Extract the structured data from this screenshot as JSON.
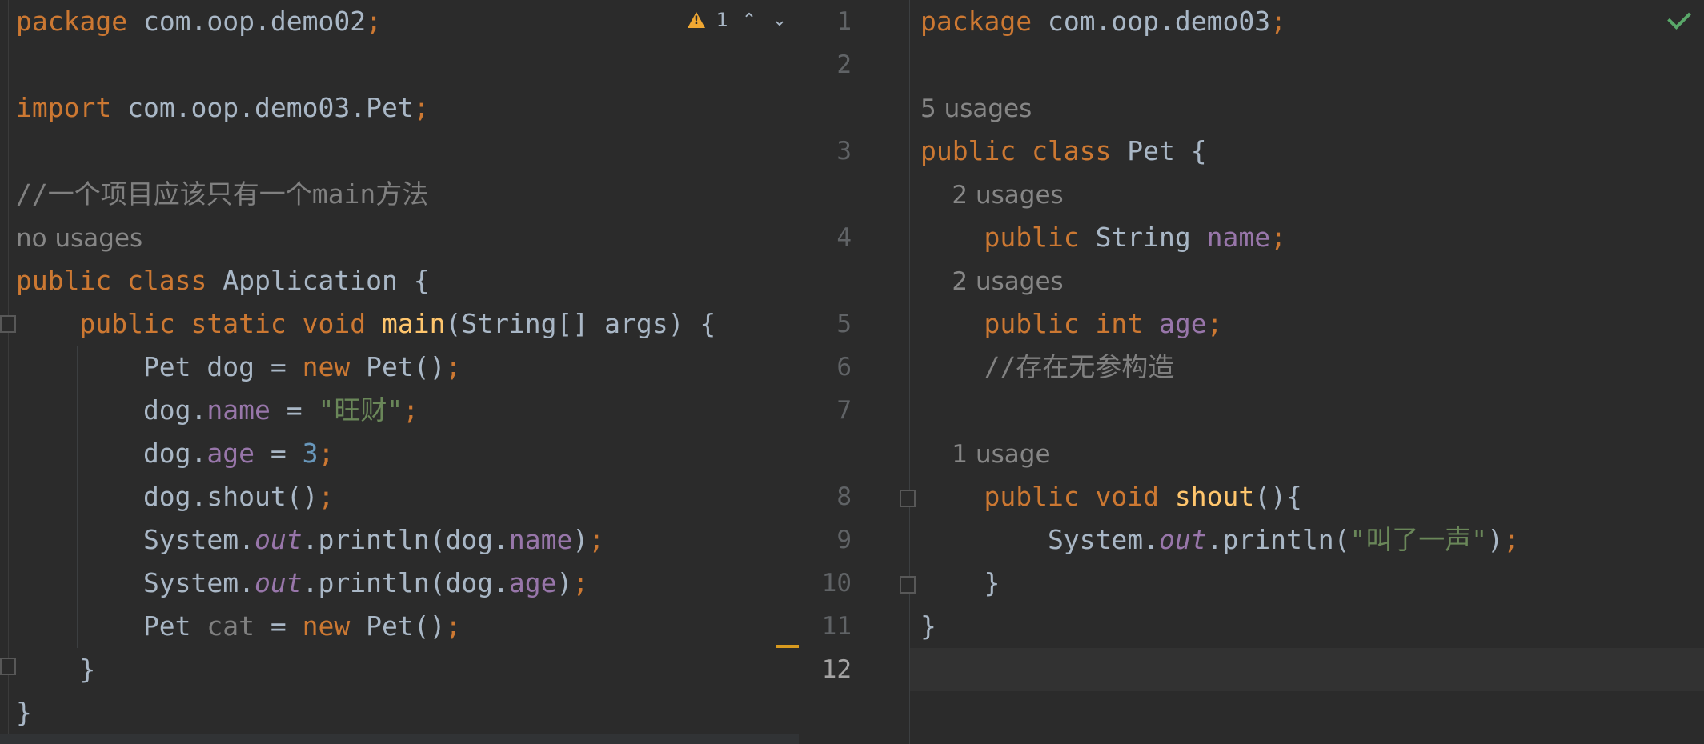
{
  "left_editor": {
    "inspections": {
      "icon": "warning-triangle-icon",
      "count": "1"
    },
    "lines": [
      {
        "segments": [
          {
            "t": "package",
            "c": "kw"
          },
          {
            "t": " com.oop.demo02",
            "c": ""
          },
          {
            "t": ";",
            "c": "pu"
          }
        ]
      },
      {
        "segments": []
      },
      {
        "segments": [
          {
            "t": "import",
            "c": "kw"
          },
          {
            "t": " com.oop.demo03.Pet",
            "c": ""
          },
          {
            "t": ";",
            "c": "pu"
          }
        ]
      },
      {
        "segments": []
      },
      {
        "segments": [
          {
            "t": "//一个项目应该只有一个main方法",
            "c": "cm"
          }
        ]
      },
      {
        "usage": "no usages"
      },
      {
        "segments": [
          {
            "t": "public class ",
            "c": "kw"
          },
          {
            "t": "Application {",
            "c": ""
          }
        ]
      },
      {
        "segments": [
          {
            "t": "    ",
            "c": ""
          },
          {
            "t": "public static void ",
            "c": "kw"
          },
          {
            "t": "main",
            "c": "fn"
          },
          {
            "t": "(String[] args) {",
            "c": ""
          }
        ]
      },
      {
        "segments": [
          {
            "t": "        Pet dog = ",
            "c": ""
          },
          {
            "t": "new ",
            "c": "kw"
          },
          {
            "t": "Pet()",
            "c": ""
          },
          {
            "t": ";",
            "c": "pu"
          }
        ]
      },
      {
        "segments": [
          {
            "t": "        dog.",
            "c": ""
          },
          {
            "t": "name",
            "c": "fd"
          },
          {
            "t": " = ",
            "c": ""
          },
          {
            "t": "\"旺财\"",
            "c": "st"
          },
          {
            "t": ";",
            "c": "pu"
          }
        ]
      },
      {
        "segments": [
          {
            "t": "        dog.",
            "c": ""
          },
          {
            "t": "age",
            "c": "fd"
          },
          {
            "t": " = ",
            "c": ""
          },
          {
            "t": "3",
            "c": "nm"
          },
          {
            "t": ";",
            "c": "pu"
          }
        ]
      },
      {
        "segments": [
          {
            "t": "        dog.shout()",
            "c": ""
          },
          {
            "t": ";",
            "c": "pu"
          }
        ]
      },
      {
        "segments": [
          {
            "t": "        System.",
            "c": ""
          },
          {
            "t": "out",
            "c": "fd it"
          },
          {
            "t": ".println(dog.",
            "c": ""
          },
          {
            "t": "name",
            "c": "fd"
          },
          {
            "t": ")",
            "c": ""
          },
          {
            "t": ";",
            "c": "pu"
          }
        ]
      },
      {
        "segments": [
          {
            "t": "        System.",
            "c": ""
          },
          {
            "t": "out",
            "c": "fd it"
          },
          {
            "t": ".println(dog.",
            "c": ""
          },
          {
            "t": "age",
            "c": "fd"
          },
          {
            "t": ")",
            "c": ""
          },
          {
            "t": ";",
            "c": "pu"
          }
        ]
      },
      {
        "segments": [
          {
            "t": "        Pet ",
            "c": ""
          },
          {
            "t": "cat",
            "c": "un"
          },
          {
            "t": " = ",
            "c": ""
          },
          {
            "t": "new ",
            "c": "kw"
          },
          {
            "t": "Pet()",
            "c": ""
          },
          {
            "t": ";",
            "c": "pu"
          }
        ]
      },
      {
        "segments": [
          {
            "t": "    }",
            "c": ""
          }
        ]
      },
      {
        "segments": [
          {
            "t": "}",
            "c": ""
          }
        ]
      }
    ]
  },
  "right_editor": {
    "status_icon": "check-icon",
    "lines": [
      {
        "num": "1",
        "segments": [
          {
            "t": "package",
            "c": "kw"
          },
          {
            "t": " com.oop.demo03",
            "c": ""
          },
          {
            "t": ";",
            "c": "pu"
          }
        ]
      },
      {
        "num": "2",
        "segments": []
      },
      {
        "usage": "5 usages"
      },
      {
        "num": "3",
        "segments": [
          {
            "t": "public class ",
            "c": "kw"
          },
          {
            "t": "Pet {",
            "c": ""
          }
        ]
      },
      {
        "usage": "    2 usages"
      },
      {
        "num": "4",
        "segments": [
          {
            "t": "    ",
            "c": ""
          },
          {
            "t": "public ",
            "c": "kw"
          },
          {
            "t": "String ",
            "c": ""
          },
          {
            "t": "name",
            "c": "fd"
          },
          {
            "t": ";",
            "c": "pu"
          }
        ]
      },
      {
        "usage": "    2 usages"
      },
      {
        "num": "5",
        "segments": [
          {
            "t": "    ",
            "c": ""
          },
          {
            "t": "public int ",
            "c": "kw"
          },
          {
            "t": "age",
            "c": "fd"
          },
          {
            "t": ";",
            "c": "pu"
          }
        ]
      },
      {
        "num": "6",
        "segments": [
          {
            "t": "    //存在无参构造",
            "c": "cm"
          }
        ]
      },
      {
        "num": "7",
        "segments": []
      },
      {
        "usage": "    1 usage"
      },
      {
        "num": "8",
        "segments": [
          {
            "t": "    ",
            "c": ""
          },
          {
            "t": "public void ",
            "c": "kw"
          },
          {
            "t": "shout",
            "c": "fn"
          },
          {
            "t": "(){",
            "c": ""
          }
        ]
      },
      {
        "num": "9",
        "segments": [
          {
            "t": "        System.",
            "c": ""
          },
          {
            "t": "out",
            "c": "fd it"
          },
          {
            "t": ".println(",
            "c": ""
          },
          {
            "t": "\"叫了一声\"",
            "c": "st"
          },
          {
            "t": ")",
            "c": ""
          },
          {
            "t": ";",
            "c": "pu"
          }
        ]
      },
      {
        "num": "10",
        "segments": [
          {
            "t": "    }",
            "c": ""
          }
        ]
      },
      {
        "num": "11",
        "segments": [
          {
            "t": "}",
            "c": ""
          }
        ]
      },
      {
        "num": "12",
        "segments": []
      }
    ]
  }
}
